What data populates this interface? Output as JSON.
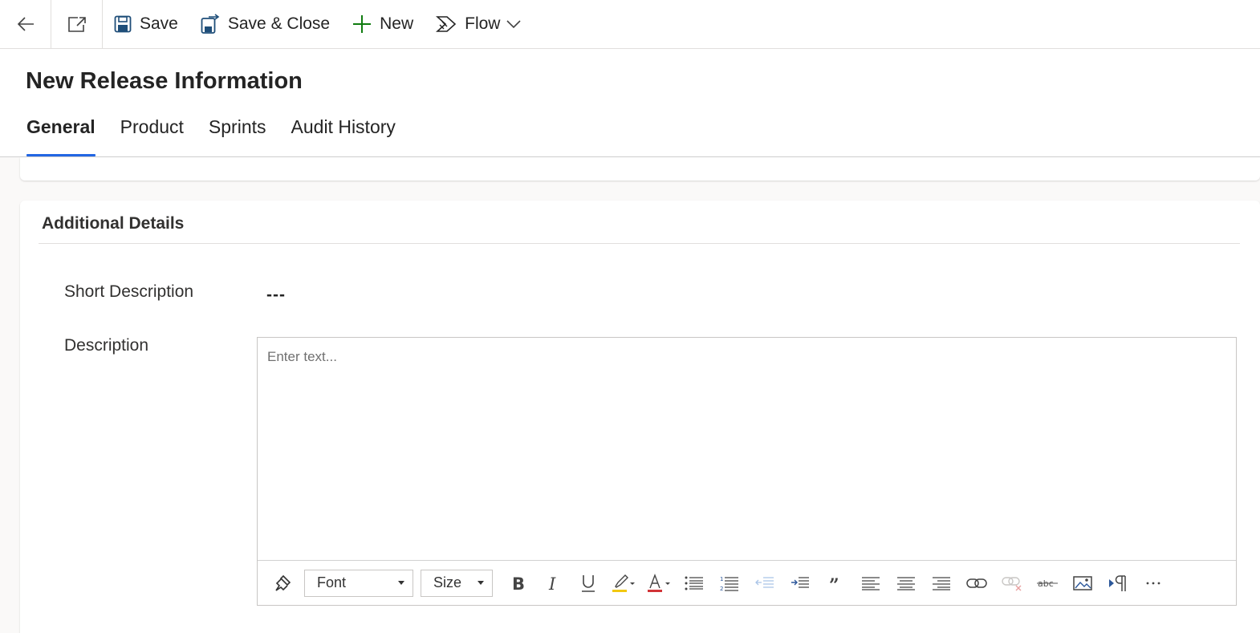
{
  "command_bar": {
    "back_icon": "arrow-left-icon",
    "popout_icon": "open-in-new-window-icon",
    "save_label": "Save",
    "save_close_label": "Save & Close",
    "new_label": "New",
    "flow_label": "Flow"
  },
  "header": {
    "title": "New Release Information",
    "tabs": [
      {
        "label": "General",
        "active": true
      },
      {
        "label": "Product",
        "active": false
      },
      {
        "label": "Sprints",
        "active": false
      },
      {
        "label": "Audit History",
        "active": false
      }
    ]
  },
  "section": {
    "title": "Additional Details",
    "fields": {
      "short_description": {
        "label": "Short Description",
        "value": "---"
      },
      "description": {
        "label": "Description",
        "placeholder": "Enter text..."
      }
    }
  },
  "editor_toolbar": {
    "font_label": "Font",
    "size_label": "Size"
  },
  "colors": {
    "accent": "#2266e3",
    "new_icon": "#107c10",
    "highlight": "#f2c811",
    "font_color": "#d13438"
  }
}
